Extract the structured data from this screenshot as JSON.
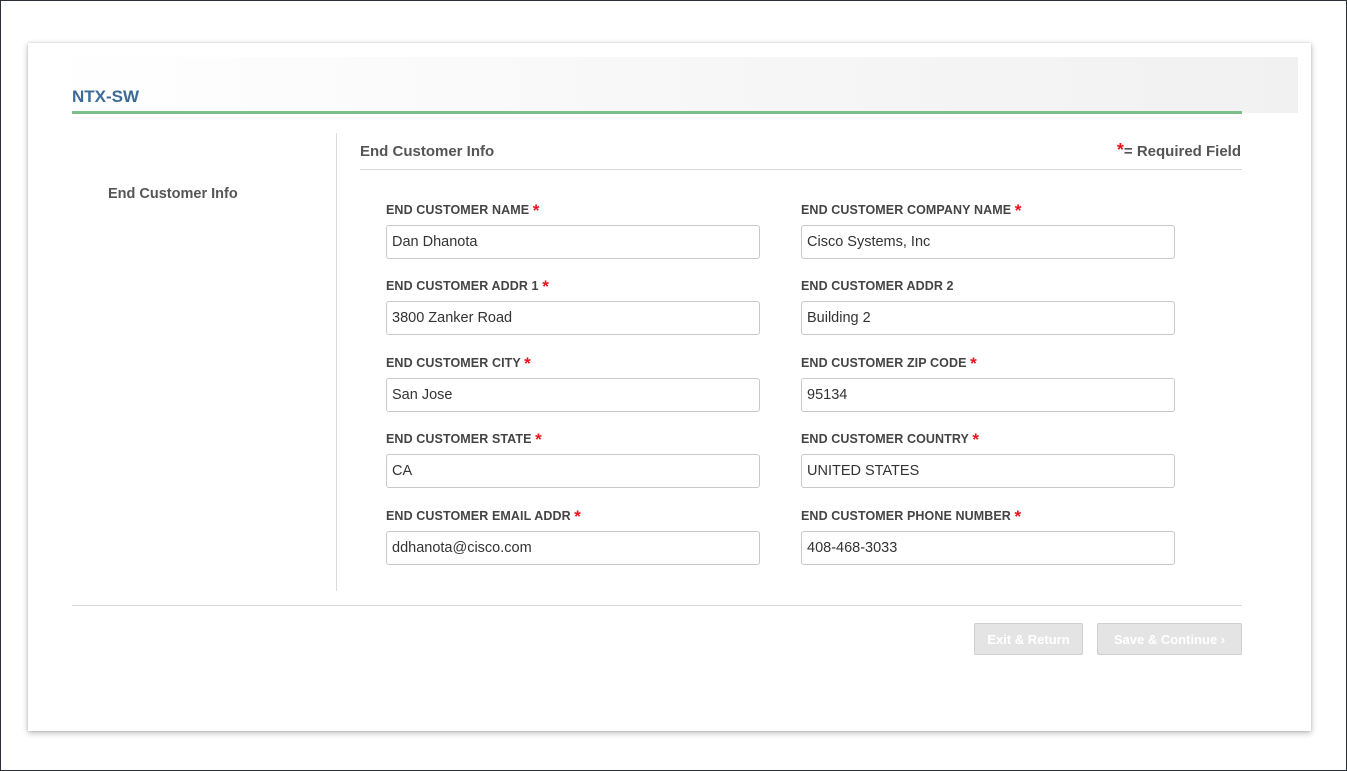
{
  "app": {
    "title": "NTX-SW"
  },
  "nav": {
    "items": [
      {
        "label": "End Customer Info"
      }
    ]
  },
  "section": {
    "title": "End Customer Info",
    "required_star": "*",
    "required_note": "= Required Field"
  },
  "form": {
    "required_marker": "*",
    "fields": [
      {
        "label": "END CUSTOMER NAME",
        "value": "Dan Dhanota",
        "required": true
      },
      {
        "label": "END CUSTOMER COMPANY NAME",
        "value": "Cisco Systems, Inc",
        "required": true
      },
      {
        "label": "END CUSTOMER ADDR 1",
        "value": "3800 Zanker Road",
        "required": true
      },
      {
        "label": "END CUSTOMER ADDR 2",
        "value": "Building 2",
        "required": false
      },
      {
        "label": "END CUSTOMER CITY",
        "value": "San Jose",
        "required": true
      },
      {
        "label": "END CUSTOMER ZIP CODE",
        "value": "95134",
        "required": true
      },
      {
        "label": "END CUSTOMER STATE",
        "value": "CA",
        "required": true
      },
      {
        "label": "END CUSTOMER COUNTRY",
        "value": "UNITED STATES",
        "required": true
      },
      {
        "label": "END CUSTOMER EMAIL ADDR",
        "value": "ddhanota@cisco.com",
        "required": true
      },
      {
        "label": "END CUSTOMER PHONE NUMBER",
        "value": "408-468-3033",
        "required": true
      }
    ]
  },
  "actions": {
    "exit_label": "Exit & Return",
    "save_label": "Save & Continue ›"
  },
  "colors": {
    "title": "#3d6b96",
    "accent_rule": "#7dbf8a",
    "required": "#e8121b",
    "button_disabled": "#e4e4e4"
  }
}
